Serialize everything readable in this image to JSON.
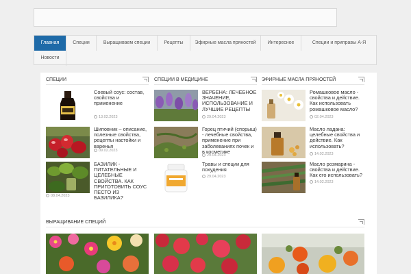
{
  "search": {
    "placeholder": ""
  },
  "nav": {
    "items": [
      {
        "label": "Главная",
        "active": true
      },
      {
        "label": "Специи"
      },
      {
        "label": "Выращиваем специи"
      },
      {
        "label": "Рецепты"
      },
      {
        "label": "Эфирные масла пряностей"
      },
      {
        "label": "Интересное"
      },
      {
        "label": "Специи и приправы А-Я"
      },
      {
        "label": "Новости"
      }
    ]
  },
  "columns": [
    {
      "title": "СПЕЦИИ",
      "items": [
        {
          "title": "Соевый соус: состав, свойства и применение",
          "date": "13.02.2023",
          "thumb": "soy-sauce-bottle"
        },
        {
          "title": "Шиповник – описание, полезные свойства, рецепты настойки и варенья",
          "date": "09.02.2023",
          "thumb": "rosehip-berries"
        },
        {
          "title": "БАЗИЛИК - ПИТАТЕЛЬНЫЕ И ЦЕЛЕБНЫЕ СВОЙСТВА. КАК ПРИГОТОВИТЬ СОУС ПЕСТО ИЗ БАЗИЛИКА?",
          "date": "08.04.2023",
          "thumb": "basil-pesto"
        }
      ]
    },
    {
      "title": "СПЕЦИИ В МЕДИЦИНЕ",
      "items": [
        {
          "title": "ВЕРБЕНА: ЛЕЧЕБНОЕ ЗНАЧЕНИЕ, ИСПОЛЬЗОВАНИЕ И ЛУЧШИЕ РЕЦЕПТЫ",
          "date": "29.04.2023",
          "thumb": "verbena-flowers"
        },
        {
          "title": "Горец птичий (спорыш) - лечебные свойства, применение при заболеваниях почек и в косметике",
          "date": "29.04.2023",
          "thumb": "knotweed-ground"
        },
        {
          "title": "Травы и специи для похудения",
          "date": "29.04.2023",
          "thumb": "supplement-jar"
        }
      ]
    },
    {
      "title": "ЭФИРНЫЕ МАСЛА ПРЯНОСТЕЙ",
      "items": [
        {
          "title": "Ромашковое масло - свойства и действие. Как использовать ромашковое масло?",
          "date": "02.04.2023",
          "thumb": "chamomile-oil"
        },
        {
          "title": "Масло ладана: целебные свойства и действие. Как использовать?",
          "date": "14.02.2023",
          "thumb": "frankincense-oil"
        },
        {
          "title": "Масло розмарина - свойства и действие. Как его использовать?",
          "date": "14.02.2023",
          "thumb": "rosemary-oil"
        }
      ]
    }
  ],
  "growing": {
    "title": "ВЫРАЩИВАНИЕ СПЕЦИЙ",
    "thumbs": [
      "portulaca-flowers",
      "bee-balm-flowers",
      "nasturtium-flowers"
    ]
  },
  "colors": {
    "accent": "#1e6aa8"
  }
}
